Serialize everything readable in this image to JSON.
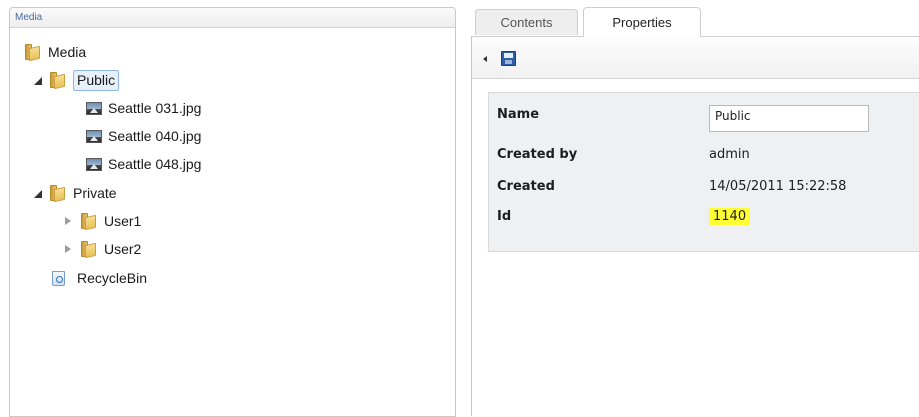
{
  "media_panel": {
    "title": "Media",
    "tree": {
      "root": "Media",
      "public": "Public",
      "files": [
        "Seattle 031.jpg",
        "Seattle 040.jpg",
        "Seattle 048.jpg"
      ],
      "private": "Private",
      "users": [
        "User1",
        "User2"
      ],
      "recycle_bin": "RecycleBin"
    }
  },
  "tabs": {
    "contents": "Contents",
    "properties": "Properties"
  },
  "properties": {
    "name_label": "Name",
    "name_value": "Public",
    "created_by_label": "Created by",
    "created_by_value": "admin",
    "created_label": "Created",
    "created_value": "14/05/2011 15:22:58",
    "id_label": "Id",
    "id_value": "1140",
    "id_highlight_color": "#ffff33"
  },
  "icons": {
    "folder": "folder-icon",
    "image": "image-icon",
    "recycle": "recycle-bin-icon",
    "save": "save-icon"
  }
}
